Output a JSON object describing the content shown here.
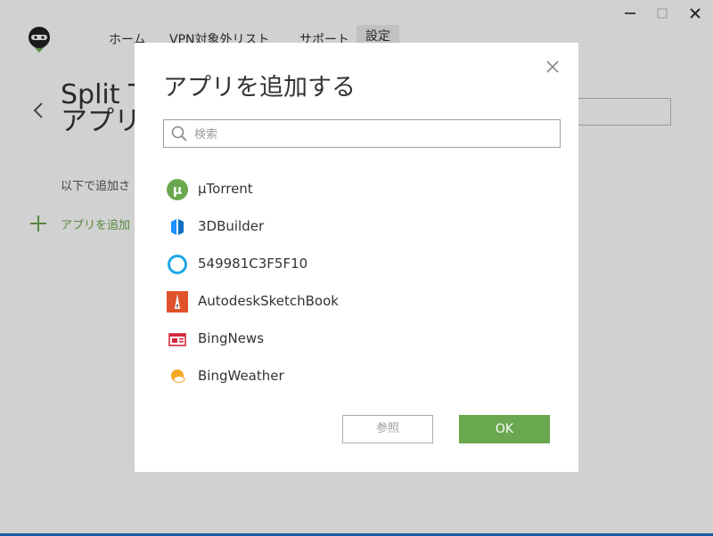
{
  "window": {
    "minimize_glyph": "▬",
    "maximize_glyph": "☐",
    "close_glyph": "✕"
  },
  "nav": {
    "tabs": [
      {
        "label": "ホーム"
      },
      {
        "label": "VPN対象外リスト"
      },
      {
        "label": "サポート"
      },
      {
        "label": "設定",
        "active": true
      }
    ]
  },
  "page": {
    "title": "Split T\nアプリ",
    "description": "以下で追加さ",
    "add_app_label": "アプリを追加"
  },
  "dialog": {
    "title": "アプリを追加する",
    "search_placeholder": "検索",
    "search_value": "",
    "apps": [
      {
        "label": "µTorrent",
        "icon": "utorrent-icon"
      },
      {
        "label": "3DBuilder",
        "icon": "3dbuilder-icon"
      },
      {
        "label": "549981C3F5F10",
        "icon": "cortana-ring-icon"
      },
      {
        "label": "AutodeskSketchBook",
        "icon": "sketchbook-icon"
      },
      {
        "label": "BingNews",
        "icon": "bingnews-icon"
      },
      {
        "label": "BingWeather",
        "icon": "bingweather-icon"
      }
    ],
    "browse_label": "参照",
    "ok_label": "OK"
  },
  "colors": {
    "accent_green": "#6aa84f",
    "overlay": "rgba(0,0,0,0.18)",
    "taskbar_blue": "#1e72c8"
  }
}
